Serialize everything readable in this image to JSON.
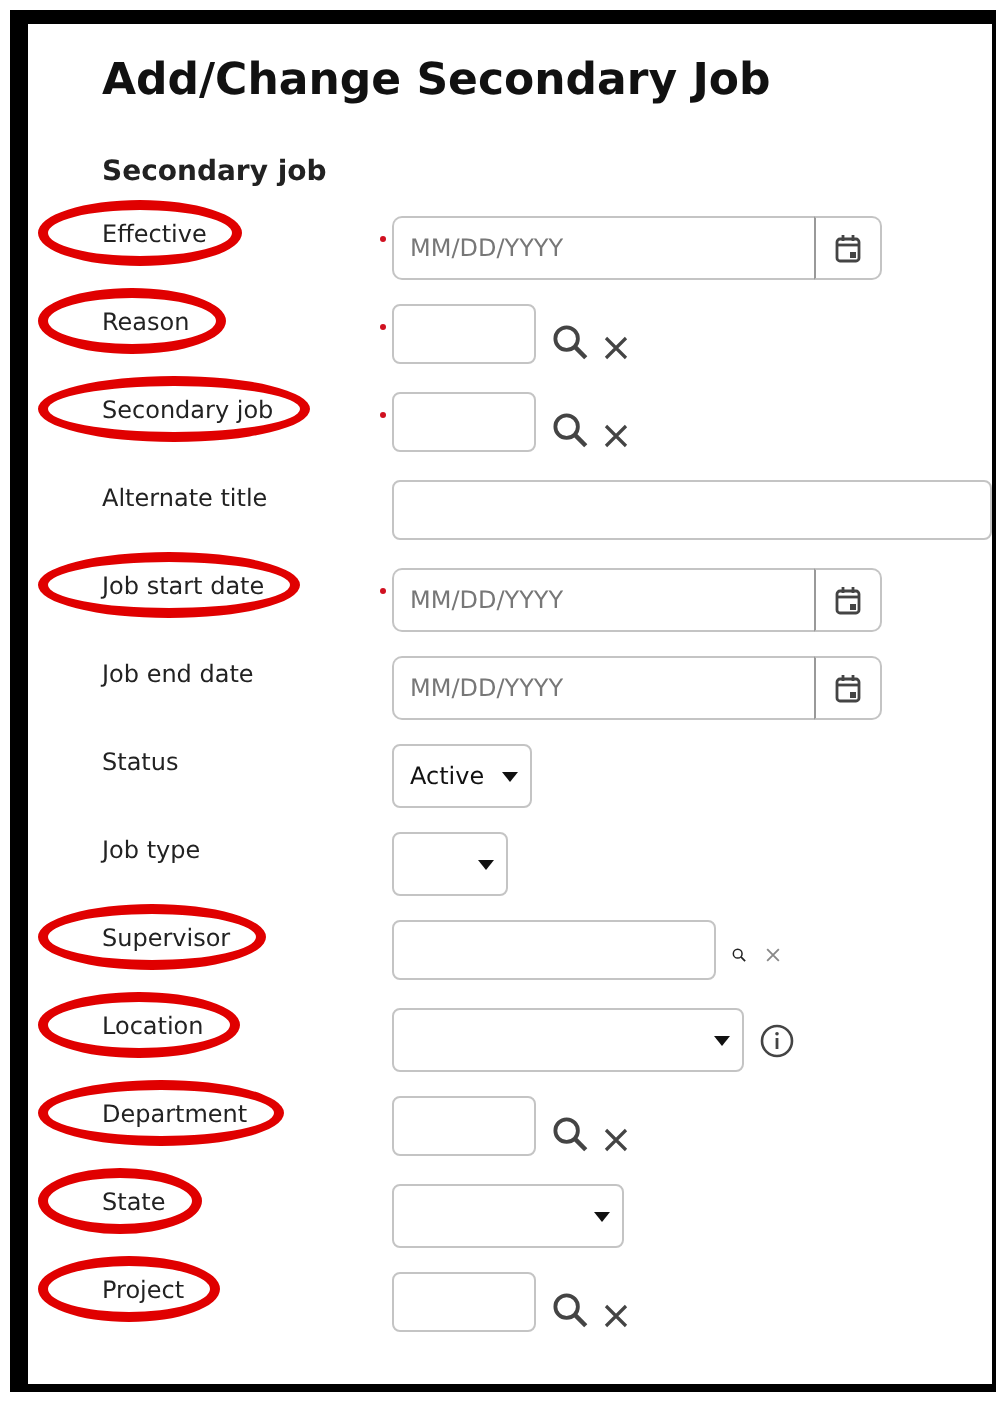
{
  "title": "Add/Change Secondary Job",
  "section": "Secondary job",
  "rows": [
    {
      "label": "Effective",
      "kind": "date",
      "required": true,
      "highlighted": true,
      "placeholder": "MM/DD/YYYY"
    },
    {
      "label": "Reason",
      "kind": "lookup",
      "required": true,
      "highlighted": true
    },
    {
      "label": "Secondary job",
      "kind": "lookup",
      "required": true,
      "highlighted": true
    },
    {
      "label": "Alternate title",
      "kind": "text",
      "required": false,
      "highlighted": false
    },
    {
      "label": "Job start date",
      "kind": "date",
      "required": true,
      "highlighted": true,
      "placeholder": "MM/DD/YYYY"
    },
    {
      "label": "Job end date",
      "kind": "date",
      "required": false,
      "highlighted": false,
      "placeholder": "MM/DD/YYYY"
    },
    {
      "label": "Status",
      "kind": "select",
      "required": false,
      "highlighted": false,
      "value": "Active"
    },
    {
      "label": "Job type",
      "kind": "select",
      "required": false,
      "highlighted": false
    },
    {
      "label": "Supervisor",
      "kind": "lookup-wide",
      "required": false,
      "highlighted": true
    },
    {
      "label": "Location",
      "kind": "select",
      "info": true,
      "required": false,
      "highlighted": true
    },
    {
      "label": "Department",
      "kind": "lookup",
      "required": false,
      "highlighted": true
    },
    {
      "label": "State",
      "kind": "select",
      "required": false,
      "highlighted": true
    },
    {
      "label": "Project",
      "kind": "lookup",
      "required": false,
      "highlighted": true
    }
  ]
}
